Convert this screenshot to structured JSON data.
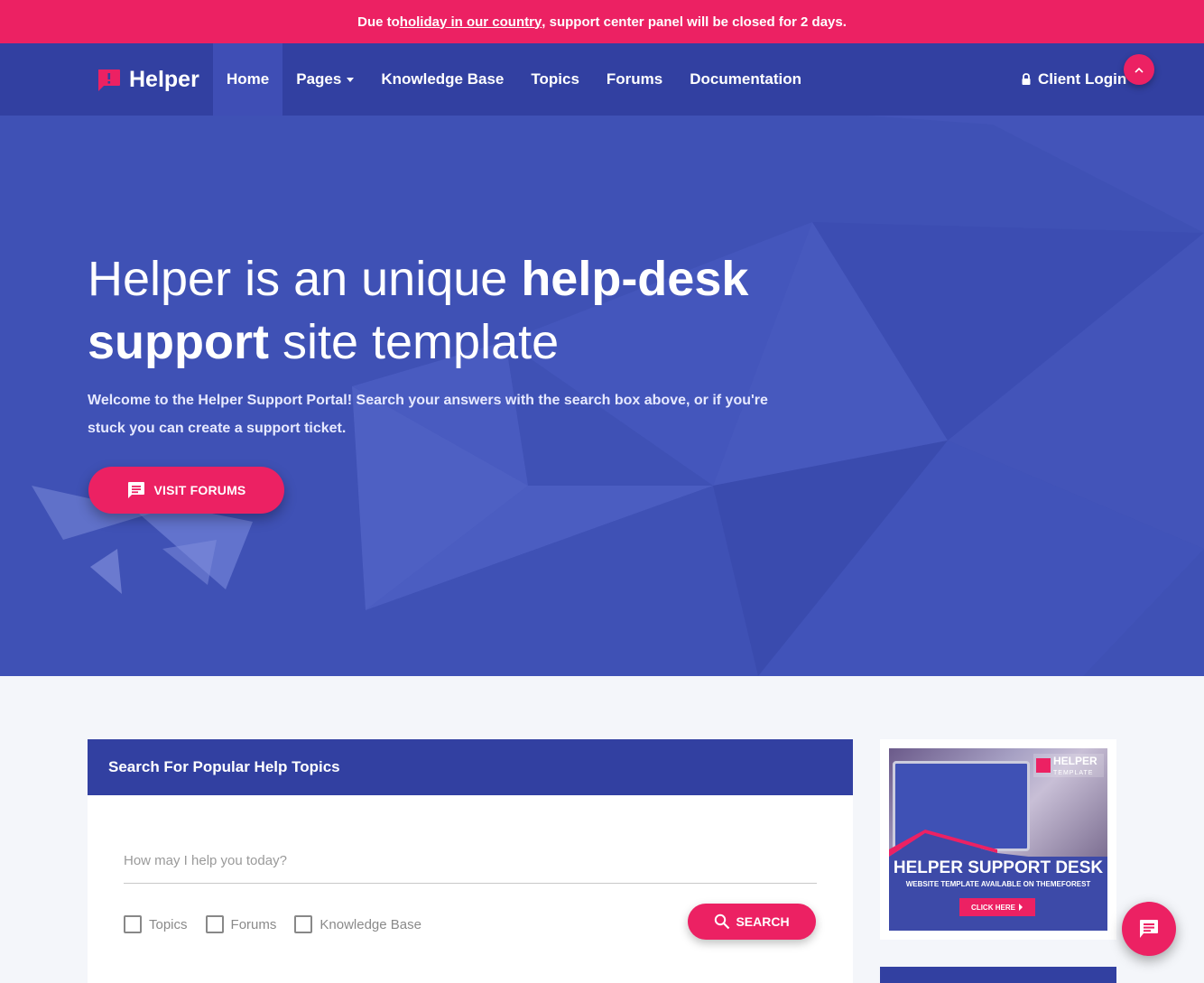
{
  "announcement": {
    "before": "Due to ",
    "link": "holiday in our country",
    "after": ", support center panel will be closed for 2 days."
  },
  "brand": {
    "name": "Helper",
    "icon": "alert-chat-icon"
  },
  "nav": {
    "items": [
      {
        "label": "Home",
        "active": true
      },
      {
        "label": "Pages",
        "dropdown": true
      },
      {
        "label": "Knowledge Base"
      },
      {
        "label": "Topics"
      },
      {
        "label": "Forums"
      },
      {
        "label": "Documentation"
      }
    ],
    "client_login": "Client Login",
    "client_login_icon": "lock-icon",
    "scroll_top_icon": "chevron-up-icon"
  },
  "hero": {
    "title_part1": "Helper is an unique ",
    "title_bold1": "help-desk",
    "title_bold2": "support",
    "title_part2": " site template",
    "text": "Welcome to the Helper Support Portal! Search your answers with the search box above, or if you're stuck you can create a support ticket.",
    "button": "VISIT FORUMS",
    "button_icon": "chat-icon"
  },
  "search": {
    "heading": "Search For Popular Help Topics",
    "placeholder": "How may I help you today?",
    "filters": [
      "Topics",
      "Forums",
      "Knowledge Base"
    ],
    "button": "SEARCH",
    "button_icon": "search-icon"
  },
  "ad": {
    "logo": "HELPER",
    "logo_sub": "TEMPLATE",
    "title": "HELPER SUPPORT DESK",
    "subtitle": "WEBSITE TEMPLATE AVAILABLE ON THEMEFOREST",
    "button": "CLICK HERE"
  },
  "chat_fab_icon": "chat-icon",
  "colors": {
    "accent": "#ec2163",
    "primary": "#3f51b5",
    "primary_dark": "#3240a1"
  }
}
